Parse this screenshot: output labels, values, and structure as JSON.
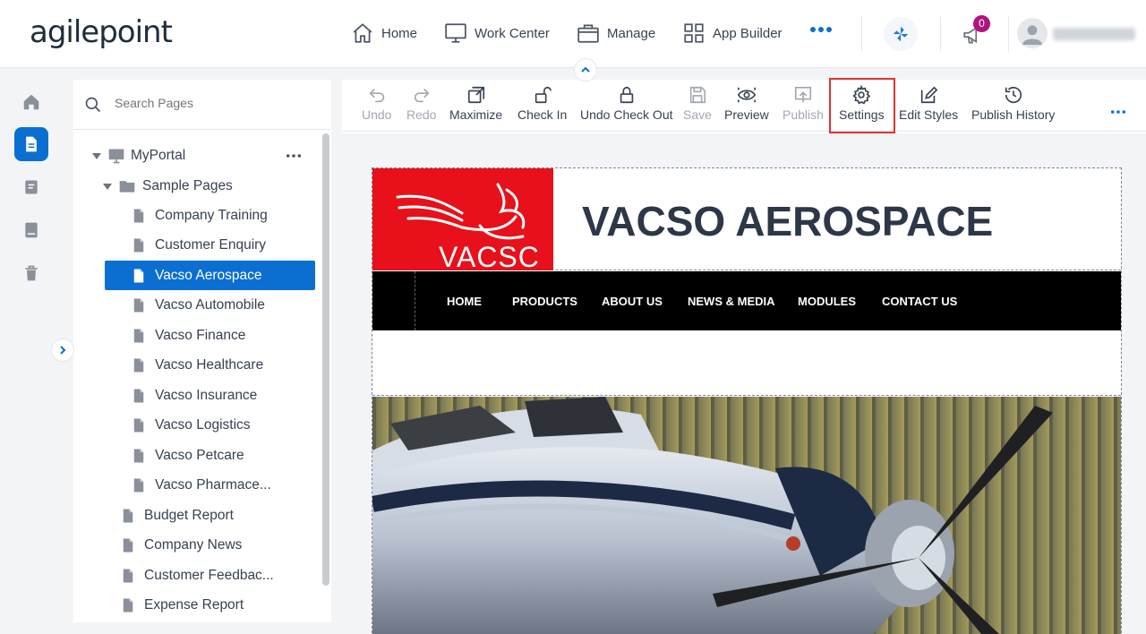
{
  "app": {
    "logo_text": "agilepoint",
    "notification_count": "0",
    "nav": [
      {
        "label": "Home",
        "icon": "home-icon"
      },
      {
        "label": "Work Center",
        "icon": "monitor-icon"
      },
      {
        "label": "Manage",
        "icon": "briefcase-icon"
      },
      {
        "label": "App Builder",
        "icon": "grid-icon"
      }
    ]
  },
  "tree": {
    "search_placeholder": "Search Pages",
    "root": "MyPortal",
    "folder": "Sample Pages",
    "folder_pages": [
      "Company Training",
      "Customer Enquiry",
      "Vacso Aerospace",
      "Vacso Automobile",
      "Vacso Finance",
      "Vacso Healthcare",
      "Vacso Insurance",
      "Vacso Logistics",
      "Vacso Petcare",
      "Vacso Pharmace..."
    ],
    "root_pages": [
      "Budget Report",
      "Company News",
      "Customer Feedbac...",
      "Expense Report"
    ],
    "selected": "Vacso Aerospace"
  },
  "toolbar": {
    "undo": "Undo",
    "redo": "Redo",
    "maximize": "Maximize",
    "check_in": "Check In",
    "undo_check_out": "Undo Check Out",
    "save": "Save",
    "preview": "Preview",
    "publish": "Publish",
    "settings": "Settings",
    "edit_styles": "Edit Styles",
    "publish_history": "Publish History"
  },
  "preview": {
    "logo_text": "VACSC",
    "site_title": "VACSO AEROSPACE",
    "menu": [
      "HOME",
      "PRODUCTS",
      "ABOUT US",
      "NEWS & MEDIA",
      "MODULES",
      "CONTACT US"
    ]
  },
  "colors": {
    "accent": "#0b6fd1",
    "highlight": "#e0342f",
    "brand_red": "#e8101a",
    "badge": "#b0127f"
  }
}
